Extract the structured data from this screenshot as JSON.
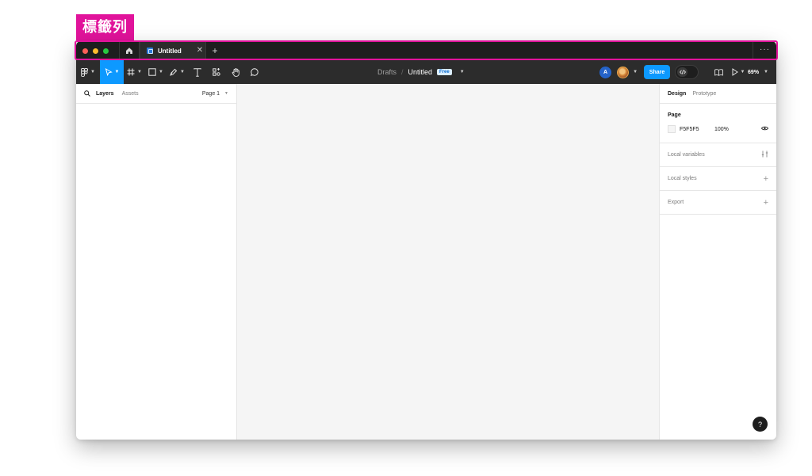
{
  "annotation": {
    "label": "標籤列",
    "color": "#e1139b"
  },
  "tabbar": {
    "tab_title": "Untitled",
    "close_glyph": "✕",
    "add_glyph": "+",
    "more_glyph": "···"
  },
  "toolbar": {
    "breadcrumb_drafts": "Drafts",
    "breadcrumb_separator": "/",
    "file_title": "Untitled",
    "plan_badge": "Free",
    "user_initial": "A",
    "share_label": "Share",
    "zoom": "69%",
    "accent_color": "#0d99ff"
  },
  "left_panel": {
    "tab_layers": "Layers",
    "tab_assets": "Assets",
    "page_selector": "Page 1"
  },
  "right_panel": {
    "tab_design": "Design",
    "tab_prototype": "Prototype",
    "page_section_title": "Page",
    "page_color_hex": "F5F5F5",
    "page_opacity": "100%",
    "local_variables": "Local variables",
    "local_styles": "Local styles",
    "export": "Export"
  },
  "help": {
    "glyph": "?"
  },
  "icons": [
    "home-icon",
    "figma-menu-icon",
    "move-icon",
    "frame-icon",
    "rectangle-icon",
    "pen-icon",
    "text-icon",
    "components-icon",
    "hand-icon",
    "comment-icon",
    "book-icon",
    "play-icon",
    "search-icon",
    "eye-icon",
    "sliders-icon",
    "plus-icon",
    "code-icon"
  ]
}
